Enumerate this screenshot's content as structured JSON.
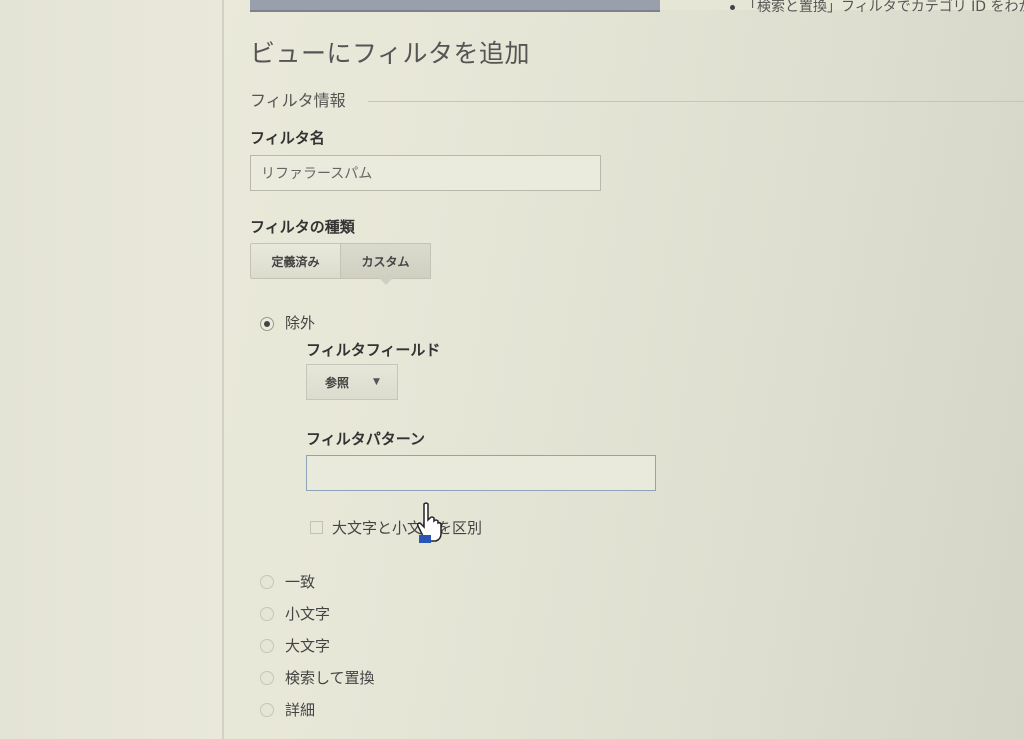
{
  "header": {
    "top_note": "「検索と置換」フィルタでカテゴリ ID をわか"
  },
  "page": {
    "title": "ビューにフィルタを追加"
  },
  "filter_info": {
    "section_label": "フィルタ情報",
    "name_label": "フィルタ名",
    "name_value": "リファラースパム",
    "type_label": "フィルタの種類",
    "type_tabs": [
      "定義済み",
      "カスタム"
    ],
    "selected_type": "カスタム"
  },
  "exclude": {
    "label": "除外",
    "selected": true,
    "field_label": "フィルタフィールド",
    "field_value": "参照",
    "pattern_label": "フィルタパターン",
    "pattern_value": "",
    "case_label": "大文字と小文字を区別",
    "case_checked": false
  },
  "other_options": [
    "一致",
    "小文字",
    "大文字",
    "検索して置換",
    "詳細"
  ],
  "colors": {
    "accent_border": "#8fa3b8",
    "cursor_accent": "#2a55b8"
  }
}
